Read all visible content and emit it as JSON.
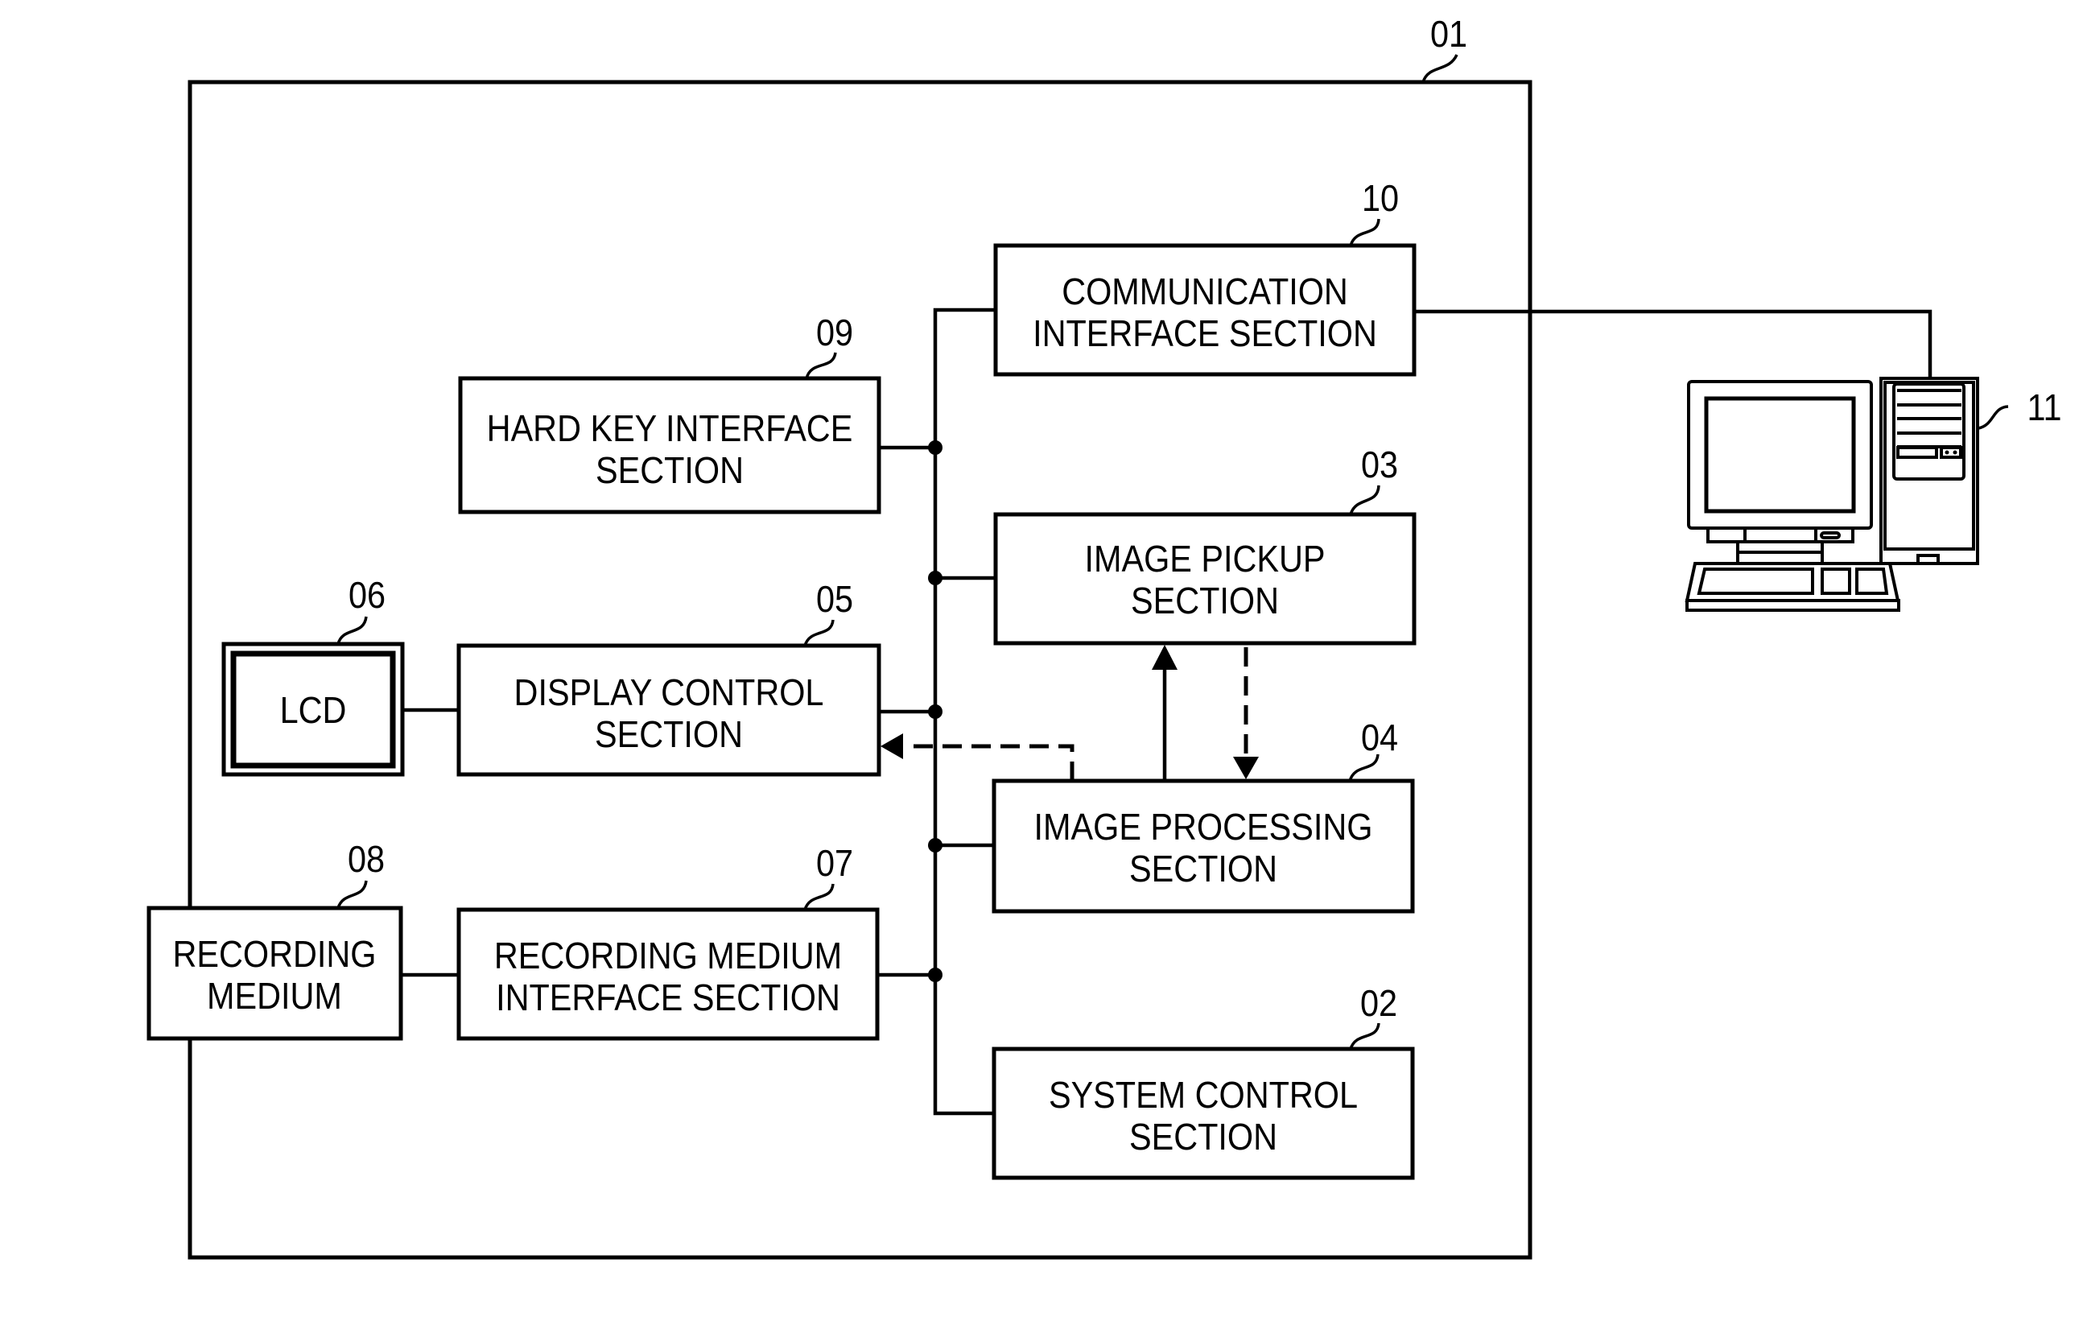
{
  "diagram": {
    "outer_ref": "01",
    "computer_ref": "11",
    "blocks": {
      "communication": {
        "ref": "10",
        "line1": "COMMUNICATION",
        "line2": "INTERFACE SECTION"
      },
      "hard_key": {
        "ref": "09",
        "line1": "HARD KEY INTERFACE",
        "line2": "SECTION"
      },
      "image_pickup": {
        "ref": "03",
        "line1": "IMAGE PICKUP",
        "line2": "SECTION"
      },
      "lcd": {
        "ref": "06",
        "line1": "LCD"
      },
      "display_control": {
        "ref": "05",
        "line1": "DISPLAY CONTROL",
        "line2": "SECTION"
      },
      "image_processing": {
        "ref": "04",
        "line1": "IMAGE PROCESSING",
        "line2": "SECTION"
      },
      "recording_medium": {
        "ref": "08",
        "line1": "RECORDING",
        "line2": "MEDIUM"
      },
      "recording_medium_if": {
        "ref": "07",
        "line1": "RECORDING MEDIUM",
        "line2": "INTERFACE SECTION"
      },
      "system_control": {
        "ref": "02",
        "line1": "SYSTEM CONTROL",
        "line2": "SECTION"
      }
    },
    "connections": [
      {
        "from": "communication",
        "to": "bus",
        "style": "solid"
      },
      {
        "from": "hard_key",
        "to": "bus",
        "style": "solid"
      },
      {
        "from": "image_pickup",
        "to": "bus",
        "style": "solid"
      },
      {
        "from": "display_control",
        "to": "bus",
        "style": "solid"
      },
      {
        "from": "image_processing",
        "to": "bus",
        "style": "solid"
      },
      {
        "from": "recording_medium_if",
        "to": "bus",
        "style": "solid"
      },
      {
        "from": "system_control",
        "to": "bus",
        "style": "solid"
      },
      {
        "from": "lcd",
        "to": "display_control",
        "style": "solid"
      },
      {
        "from": "recording_medium",
        "to": "recording_medium_if",
        "style": "solid"
      },
      {
        "from": "image_processing",
        "to": "image_pickup",
        "style": "solid-arrow"
      },
      {
        "from": "image_pickup",
        "to": "image_processing",
        "style": "dashed-arrow"
      },
      {
        "from": "image_processing",
        "to": "display_control",
        "style": "dashed-arrow"
      },
      {
        "from": "communication",
        "to": "computer",
        "style": "solid"
      }
    ]
  }
}
